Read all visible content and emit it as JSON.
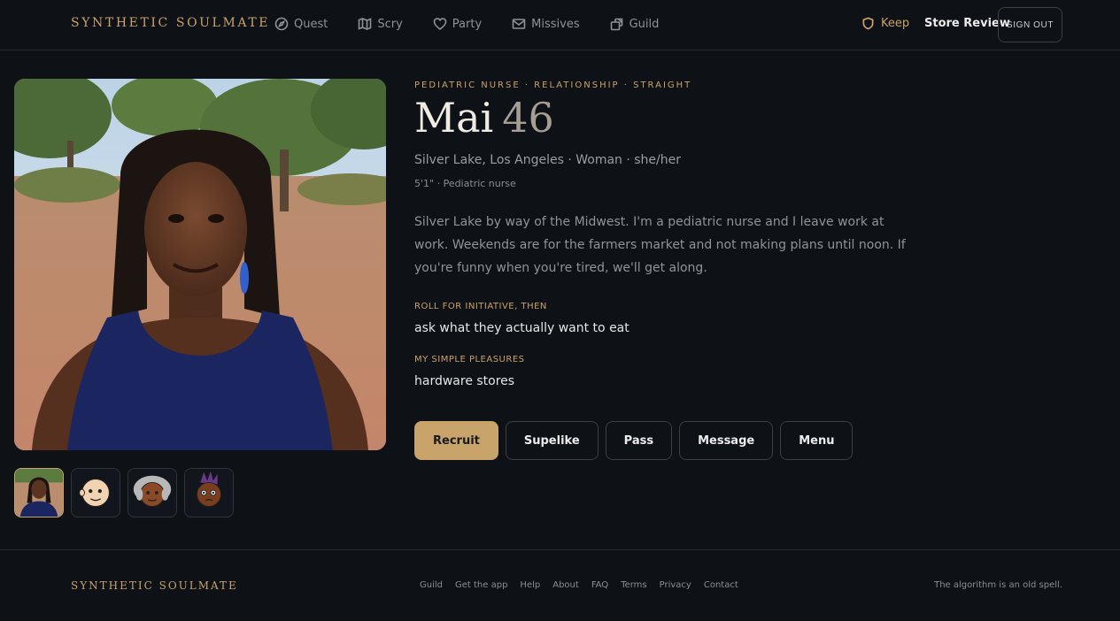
{
  "header": {
    "brand": "SYNTHETIC SOULMATE",
    "nav": [
      {
        "label": "Quest",
        "icon": "compass-icon"
      },
      {
        "label": "Scry",
        "icon": "map-icon"
      },
      {
        "label": "Party",
        "icon": "heart-icon"
      },
      {
        "label": "Missives",
        "icon": "mail-icon"
      },
      {
        "label": "Guild",
        "icon": "guild-icon"
      }
    ],
    "keep_label": "Keep",
    "store_review_label": "Store Review",
    "sign_out_label": "SIGN OUT"
  },
  "profile": {
    "tagline": "PEDIATRIC NURSE · RELATIONSHIP · STRAIGHT",
    "name": "Mai",
    "age": "46",
    "location": "Silver Lake, Los Angeles · Woman · she/her",
    "meta": "5'1\" · Pediatric nurse",
    "bio": "Silver Lake by way of the Midwest. I'm a pediatric nurse and I leave work at work. Weekends are for the farmers market and not making plans until noon. If you're funny when you're tired, we'll get along.",
    "prompts": [
      {
        "label": "ROLL FOR INITIATIVE, THEN",
        "answer": "ask what they actually want to eat"
      },
      {
        "label": "MY SIMPLE PLEASURES",
        "answer": "hardware stores"
      }
    ],
    "photo_thumbnails": [
      {
        "kind": "photo",
        "active": true
      },
      {
        "kind": "cartoon-bald-avatar",
        "active": false
      },
      {
        "kind": "cartoon-grey-hair-avatar",
        "active": false
      },
      {
        "kind": "cartoon-purple-hair-avatar",
        "active": false
      }
    ]
  },
  "actions": {
    "recruit": "Recruit",
    "superlike": "Supelike",
    "pass": "Pass",
    "message": "Message",
    "menu": "Menu"
  },
  "footer": {
    "brand": "SYNTHETIC SOULMATE",
    "links": [
      "Guild",
      "Get the app",
      "Help",
      "About",
      "FAQ",
      "Terms",
      "Privacy",
      "Contact"
    ],
    "note": "The algorithm is an old spell."
  },
  "colors": {
    "background": "#0e1116",
    "accent": "#c8a36a",
    "text_muted": "#8f939a",
    "border": "#30343b"
  }
}
